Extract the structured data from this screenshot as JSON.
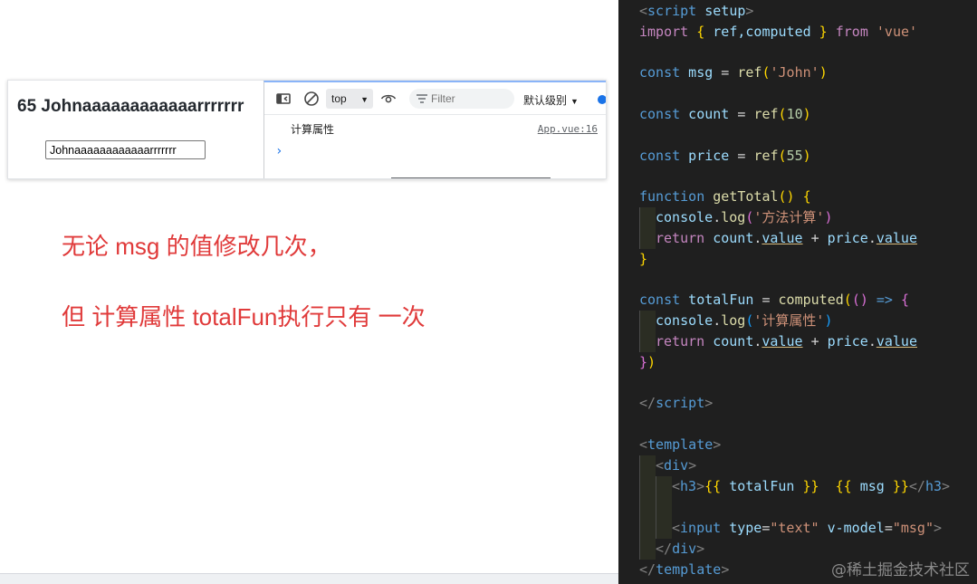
{
  "preview": {
    "heading": "65 Johnaaaaaaaaaaaarrrrrrr",
    "input_value": "Johnaaaaaaaaaaaarrrrrrr"
  },
  "devtools": {
    "context": "top",
    "filter_placeholder": "Filter",
    "levels": "默认级别",
    "console_message": "计算属性",
    "console_source": "App.vue:16",
    "prompt": "›",
    "icons": [
      "dock-icon",
      "clear-icon",
      "eye-icon",
      "filter-icon",
      "settings-icon"
    ]
  },
  "annotations": [
    "无论 msg 的值修改几次，",
    "但 计算属性 totalFun执行只有 一次"
  ],
  "code": {
    "l1_open": "<",
    "l1_tag": "script",
    "l1_attr": " setup",
    "l1_close": ">",
    "l2_import": "import",
    "l2_b1": " { ",
    "l2_names": "ref,computed",
    "l2_b2": " } ",
    "l2_from": "from",
    "l2_mod": " 'vue'",
    "l3_const": "const",
    "l3_name": " msg",
    "l3_eq": " = ",
    "l3_fn": "ref",
    "l3_p1": "(",
    "l3_str": "'John'",
    "l3_p2": ")",
    "l4_const": "const",
    "l4_name": " count",
    "l4_eq": " = ",
    "l4_fn": "ref",
    "l4_p1": "(",
    "l4_num": "10",
    "l4_p2": ")",
    "l5_const": "const",
    "l5_name": " price",
    "l5_eq": " = ",
    "l5_fn": "ref",
    "l5_p1": "(",
    "l5_num": "55",
    "l5_p2": ")",
    "l6_kw": "function",
    "l6_fn": " getTotal",
    "l6_paren": "()",
    "l6_brace": " {",
    "l7_obj": "console",
    "l7_dot": ".",
    "l7_fn": "log",
    "l7_p1": "(",
    "l7_str": "'方法计算'",
    "l7_p2": ")",
    "l8_ret": "return",
    "l8_a": " count",
    "l8_d1": ".",
    "l8_av": "value",
    "l8_plus": " + ",
    "l8_b": "price",
    "l8_d2": ".",
    "l8_bv": "value",
    "l9_brace": "}",
    "l10_const": "const",
    "l10_name": " totalFun",
    "l10_eq": " = ",
    "l10_fn": "computed",
    "l10_p1": "(",
    "l10_p2": "()",
    "l10_arrow": " => ",
    "l10_brace": "{",
    "l11_obj": "console",
    "l11_dot": ".",
    "l11_fn": "log",
    "l11_p1": "(",
    "l11_str": "'计算属性'",
    "l11_p2": ")",
    "l12_ret": "return",
    "l12_a": " count",
    "l12_d1": ".",
    "l12_av": "value",
    "l12_plus": " + ",
    "l12_b": "price",
    "l12_d2": ".",
    "l12_bv": "value",
    "l13_brace": "}",
    "l13_paren": ")",
    "l14_open": "</",
    "l14_tag": "script",
    "l14_close": ">",
    "l15_open": "<",
    "l15_tag": "template",
    "l15_close": ">",
    "l16_open": "<",
    "l16_tag": "div",
    "l16_close": ">",
    "l17_open": "<",
    "l17_tag": "h3",
    "l17_close": ">",
    "l17_m1o": "{{",
    "l17_m1": " totalFun ",
    "l17_m1c": "}}",
    "l17_sp": "  ",
    "l17_m2o": "{{",
    "l17_m2": " msg ",
    "l17_m2c": "}}",
    "l17_end_open": "</",
    "l17_end_tag": "h3",
    "l17_end_close": ">",
    "l18_open": "<",
    "l18_tag": "input",
    "l18_a1": " type",
    "l18_eq1": "=",
    "l18_v1": "\"text\"",
    "l18_a2": " v-model",
    "l18_eq2": "=",
    "l18_v2": "\"msg\"",
    "l18_close": ">",
    "l19_open": "</",
    "l19_tag": "div",
    "l19_close": ">",
    "l20_open": "</",
    "l20_tag": "template",
    "l20_close": ">"
  },
  "watermark": "@稀土掘金技术社区"
}
